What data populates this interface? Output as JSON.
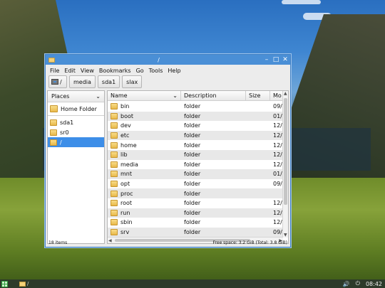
{
  "window": {
    "title": "/"
  },
  "menu": [
    "File",
    "Edit",
    "View",
    "Bookmarks",
    "Go",
    "Tools",
    "Help"
  ],
  "location": {
    "root": "/",
    "crumbs": [
      "media",
      "sda1",
      "slax"
    ]
  },
  "sidebar": {
    "header": "Places",
    "items": [
      {
        "label": "Home Folder"
      },
      {
        "label": "sda1"
      },
      {
        "label": "sr0"
      },
      {
        "label": "/"
      }
    ]
  },
  "columns": {
    "name": "Name",
    "description": "Description",
    "size": "Size",
    "modified": "Mo"
  },
  "files": [
    {
      "name": "bin",
      "description": "folder",
      "size": "",
      "modified": "09/"
    },
    {
      "name": "boot",
      "description": "folder",
      "size": "",
      "modified": "01/"
    },
    {
      "name": "dev",
      "description": "folder",
      "size": "",
      "modified": "12/"
    },
    {
      "name": "etc",
      "description": "folder",
      "size": "",
      "modified": "12/"
    },
    {
      "name": "home",
      "description": "folder",
      "size": "",
      "modified": "12/"
    },
    {
      "name": "lib",
      "description": "folder",
      "size": "",
      "modified": "12/"
    },
    {
      "name": "media",
      "description": "folder",
      "size": "",
      "modified": "12/"
    },
    {
      "name": "mnt",
      "description": "folder",
      "size": "",
      "modified": "01/"
    },
    {
      "name": "opt",
      "description": "folder",
      "size": "",
      "modified": "09/"
    },
    {
      "name": "proc",
      "description": "folder",
      "size": "",
      "modified": ""
    },
    {
      "name": "root",
      "description": "folder",
      "size": "",
      "modified": "12/"
    },
    {
      "name": "run",
      "description": "folder",
      "size": "",
      "modified": "12/"
    },
    {
      "name": "sbin",
      "description": "folder",
      "size": "",
      "modified": "12/"
    },
    {
      "name": "srv",
      "description": "folder",
      "size": "",
      "modified": "09/"
    }
  ],
  "status": {
    "items": "18 items",
    "free_space": "Free space: 3.2 GiB (Total: 3.8 GiB)"
  },
  "taskbar": {
    "task_label": "/",
    "clock": "08:42"
  }
}
